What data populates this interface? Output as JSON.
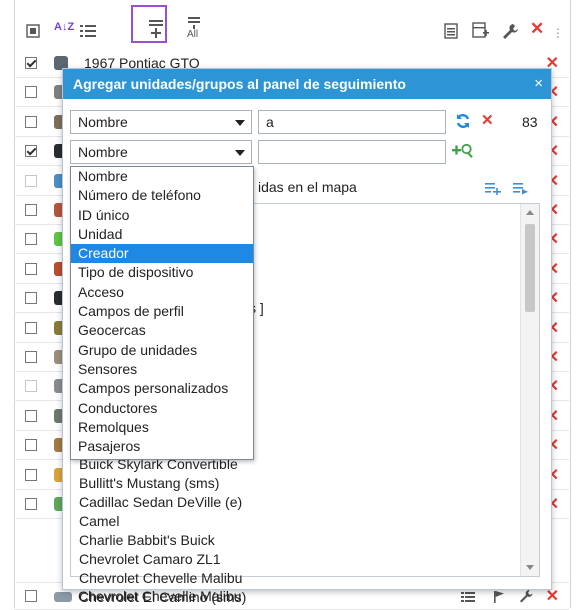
{
  "toolbar": {
    "sort_az": "A↓Z",
    "icons": [
      "select-all-icon",
      "sort-az-icon",
      "list-icon",
      "add-to-list-icon",
      "add-all-icon",
      "text-file-icon",
      "add-layout-icon",
      "wrench-icon",
      "close-icon"
    ]
  },
  "background_rows": [
    {
      "checked": true,
      "name": "1967 Pontiac GTO",
      "disabled": false
    },
    {
      "checked": false,
      "name": "",
      "disabled": false
    },
    {
      "checked": false,
      "name": "",
      "disabled": false
    },
    {
      "checked": true,
      "name": "",
      "disabled": false
    },
    {
      "checked": false,
      "name": "",
      "disabled": true
    },
    {
      "checked": false,
      "name": "",
      "disabled": false
    },
    {
      "checked": false,
      "name": "",
      "disabled": false
    },
    {
      "checked": false,
      "name": "",
      "disabled": false
    },
    {
      "checked": false,
      "name": "",
      "disabled": false
    },
    {
      "checked": false,
      "name": "",
      "disabled": false
    },
    {
      "checked": false,
      "name": "",
      "disabled": false
    },
    {
      "checked": false,
      "name": "",
      "disabled": true
    },
    {
      "checked": false,
      "name": "",
      "disabled": false
    },
    {
      "checked": false,
      "name": "",
      "disabled": false
    },
    {
      "checked": false,
      "name": "",
      "disabled": false
    },
    {
      "checked": false,
      "name": "",
      "disabled": false
    }
  ],
  "bottom_row": {
    "name": "Chevrolet Chevelle Malibu"
  },
  "dialog": {
    "title": "Agregar unidades/grupos al panel de seguimiento",
    "close": "×",
    "filter1": {
      "field": "Nombre",
      "value": "a",
      "count": "83"
    },
    "filter2": {
      "field": "Nombre",
      "value": ""
    },
    "list_header": "idas en el mapa",
    "dropdown_options": [
      "Nombre",
      "Número de teléfono",
      "ID único",
      "Unidad",
      "Creador",
      "Tipo de dispositivo",
      "Acceso",
      "Campos de perfil",
      "Geocercas",
      "Grupo de unidades",
      "Sensores",
      "Campos personalizados",
      "Conductores",
      "Remolques",
      "Pasajeros"
    ],
    "dropdown_active_index": 4,
    "partial_bracket": "s ]",
    "list_items": [
      "Buick Skylark Convertible",
      "Bullitt's Mustang (sms)",
      "Cadillac Sedan DeVille (e)",
      "Camel",
      "Charlie Babbit's Buick",
      "Chevrolet Camaro ZL1",
      "Chevrolet Chevelle Malibu",
      "Chevrolet El Camino (sms)"
    ]
  },
  "colors": {
    "title_bar": "#2d95d6",
    "active_option": "#1e88e5",
    "delete_red": "#e53935",
    "highlight_border": "#9b4fd1",
    "refresh_blue": "#1e88e5",
    "add_green": "#43a047"
  }
}
